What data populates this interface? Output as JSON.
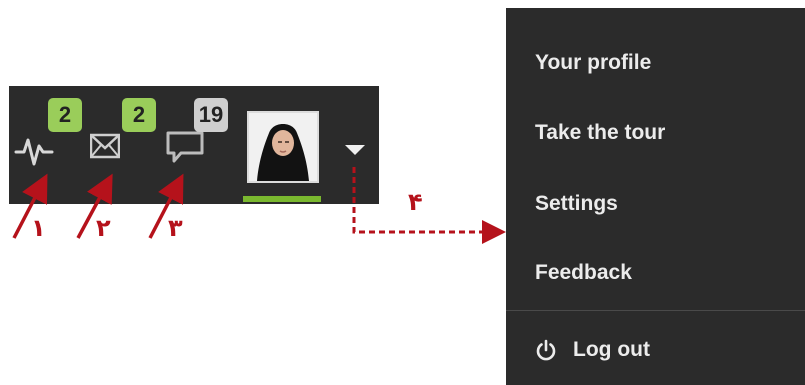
{
  "toolbar": {
    "activity_icon": "activity-pulse-icon",
    "messages_icon": "envelope-icon",
    "comments_icon": "chat-bubble-icon",
    "activity_badge": "2",
    "messages_badge": "2",
    "comments_badge": "19",
    "dropdown_icon": "triangle-down-icon"
  },
  "menu": {
    "items": [
      {
        "label": "Your profile"
      },
      {
        "label": "Take the tour"
      },
      {
        "label": "Settings"
      },
      {
        "label": "Feedback"
      }
    ],
    "logout_label": "Log out",
    "logout_icon": "power-icon"
  },
  "annotations": {
    "labels": [
      "۱",
      "۲",
      "۳",
      "۴"
    ],
    "color": "#b5121b"
  },
  "colors": {
    "bar_background": "#2b2b2b",
    "badge_green": "#9acd5a",
    "badge_grey": "#cfcfcf",
    "avatar_underline": "#7ab82f"
  }
}
